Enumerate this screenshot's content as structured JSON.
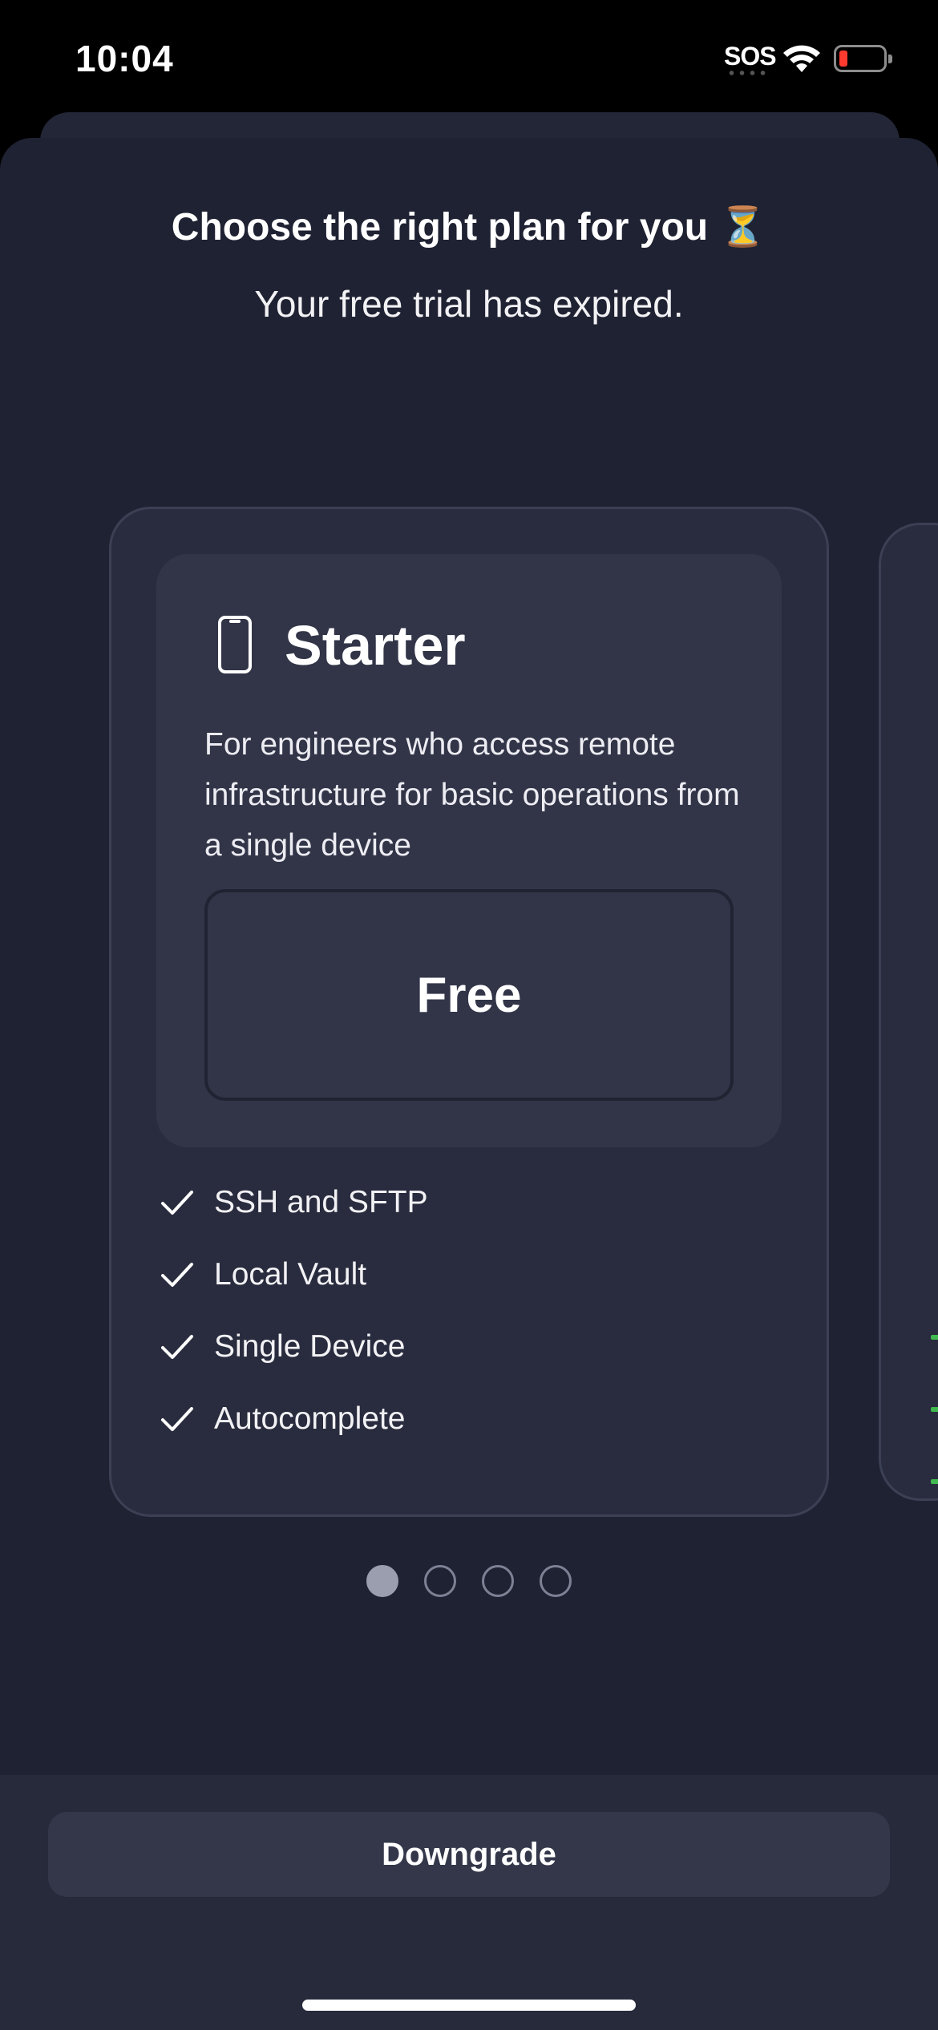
{
  "status_bar": {
    "time": "10:04",
    "sos": "SOS",
    "icons": [
      "wifi-icon",
      "battery-low-icon"
    ]
  },
  "header": {
    "title": "Choose the right plan for you ⏳",
    "subtitle": "Your free trial has expired."
  },
  "plan": {
    "icon": "phone-icon",
    "name": "Starter",
    "description": "For engineers who access remote infrastructure for basic operations from a single device",
    "price": "Free",
    "features": [
      "SSH and SFTP",
      "Local Vault",
      "Single Device",
      "Autocomplete"
    ]
  },
  "pager": {
    "total": 4,
    "active_index": 0
  },
  "footer": {
    "downgrade_label": "Downgrade"
  },
  "colors": {
    "background": "#1f2232",
    "card": "#292c3e",
    "card_inner": "#323548",
    "battery_low": "#ff3b30",
    "peek_check": "#3fb950"
  }
}
